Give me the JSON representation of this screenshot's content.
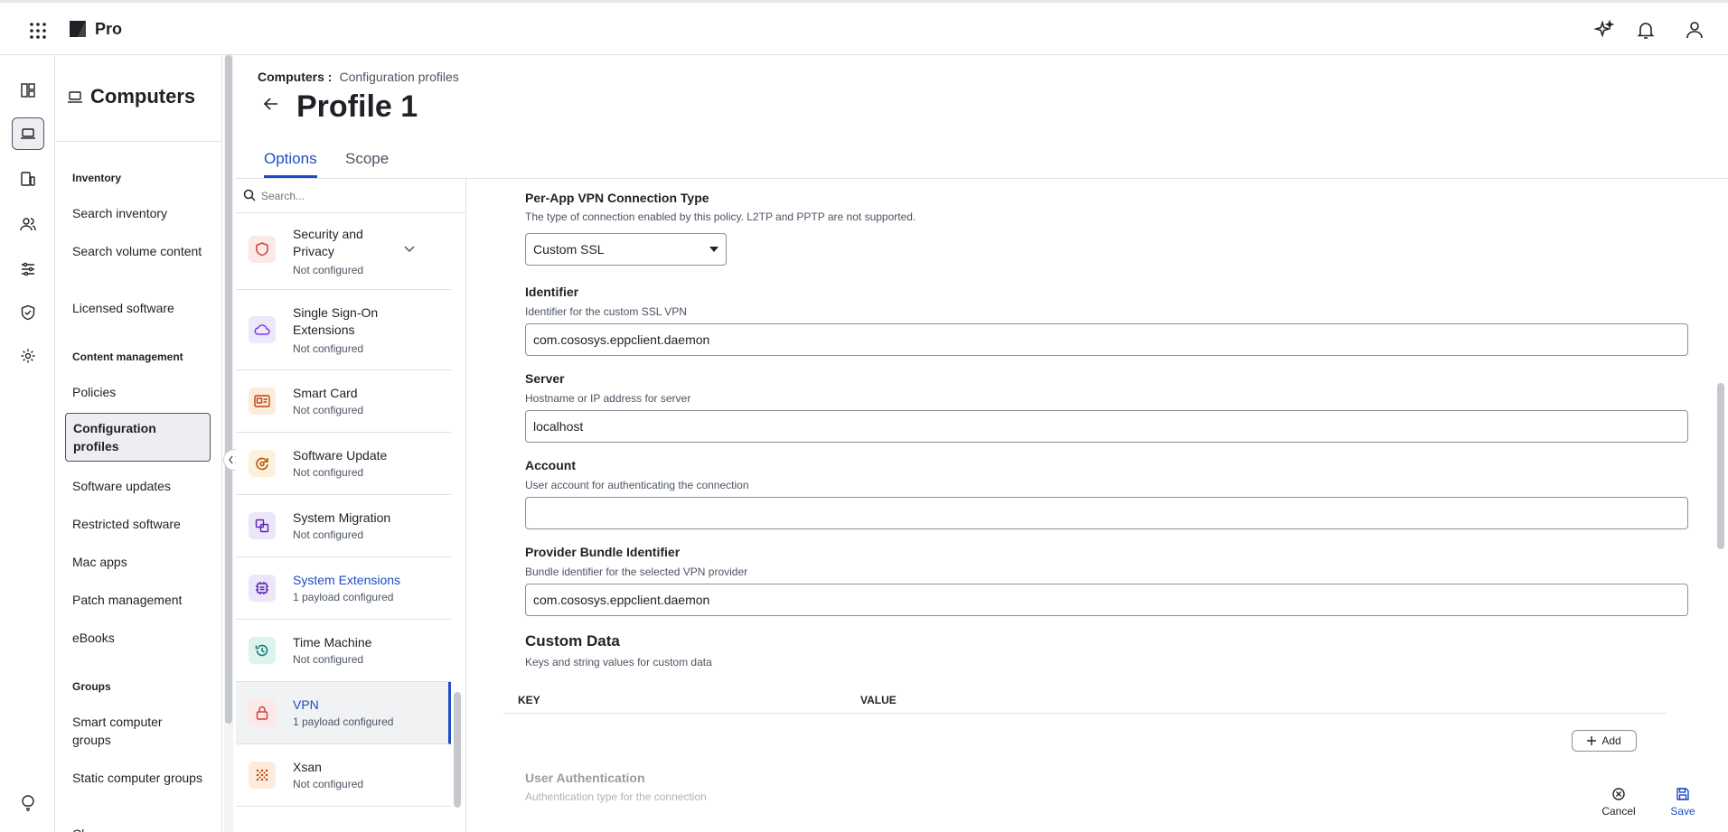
{
  "app": {
    "brand": "Pro"
  },
  "topbar": {
    "icons": [
      "apps-grid-icon",
      "sparkle-icon",
      "bell-icon",
      "user-icon"
    ]
  },
  "rail": {
    "icons": [
      "dashboard-icon",
      "computer-icon",
      "devices-icon",
      "users-icon",
      "settings-sliders-icon",
      "shield-icon",
      "gear-icon",
      "lightbulb-icon"
    ],
    "active": "computer-icon"
  },
  "nav": {
    "title": "Computers",
    "sections": [
      {
        "title": "Inventory",
        "items": [
          "Search inventory",
          "Search volume content",
          "Licensed software"
        ]
      },
      {
        "title": "Content management",
        "items": [
          "Policies",
          "Configuration profiles",
          "Software updates",
          "Restricted software",
          "Mac apps",
          "Patch management",
          "eBooks"
        ]
      },
      {
        "title": "Groups",
        "items": [
          "Smart computer groups",
          "Static computer groups",
          "Cl..."
        ]
      }
    ],
    "active_item": "Configuration profiles"
  },
  "breadcrumb": {
    "parent": "Computers :",
    "current": "Configuration profiles"
  },
  "page": {
    "title": "Profile 1"
  },
  "tabs": [
    {
      "label": "Options",
      "active": true
    },
    {
      "label": "Scope",
      "active": false
    }
  ],
  "payloads": {
    "search_placeholder": "Search...",
    "items": [
      {
        "name": "Security and Privacy",
        "status": "Not configured",
        "icon": "shield-icon",
        "color": "#d13f3f"
      },
      {
        "name": "Single Sign-On Extensions",
        "status": "Not configured",
        "icon": "cloud-icon",
        "color": "#7c3aed"
      },
      {
        "name": "Smart Card",
        "status": "Not configured",
        "icon": "id-card-icon",
        "color": "#c2410c"
      },
      {
        "name": "Software Update",
        "status": "Not configured",
        "icon": "refresh-gear-icon",
        "color": "#b45309"
      },
      {
        "name": "System Migration",
        "status": "Not configured",
        "icon": "migration-icon",
        "color": "#5b21b6"
      },
      {
        "name": "System Extensions",
        "status": "1 payload configured",
        "icon": "chip-icon",
        "color": "#5b21b6"
      },
      {
        "name": "Time Machine",
        "status": "Not configured",
        "icon": "history-icon",
        "color": "#0f766e"
      },
      {
        "name": "VPN",
        "status": "1 payload configured",
        "icon": "lock-icon",
        "color": "#d13f3f"
      },
      {
        "name": "Xsan",
        "status": "Not configured",
        "icon": "grid-dots-icon",
        "color": "#c2410c"
      }
    ]
  },
  "form": {
    "connection_type": {
      "label": "Per-App VPN Connection Type",
      "desc": "The type of connection enabled by this policy. L2TP and PPTP are not supported.",
      "value": "Custom SSL"
    },
    "identifier": {
      "label": "Identifier",
      "desc": "Identifier for the custom SSL VPN",
      "value": "com.cososys.eppclient.daemon"
    },
    "server": {
      "label": "Server",
      "desc": "Hostname or IP address for server",
      "value": "localhost"
    },
    "account": {
      "label": "Account",
      "desc": "User account for authenticating the connection",
      "value": ""
    },
    "bundle": {
      "label": "Provider Bundle Identifier",
      "desc": "Bundle identifier for the selected VPN provider",
      "value": "com.cososys.eppclient.daemon"
    },
    "custom_data": {
      "title": "Custom Data",
      "desc": "Keys and string values for custom data",
      "key_header": "KEY",
      "value_header": "VALUE",
      "add_label": "Add"
    },
    "user_auth": {
      "label": "User Authentication",
      "desc": "Authentication type for the connection"
    }
  },
  "actions": {
    "cancel": "Cancel",
    "save": "Save"
  },
  "colors": {
    "accent": "#1f4bc4",
    "border": "#dfe1e5",
    "text_secondary": "#4b5563"
  }
}
